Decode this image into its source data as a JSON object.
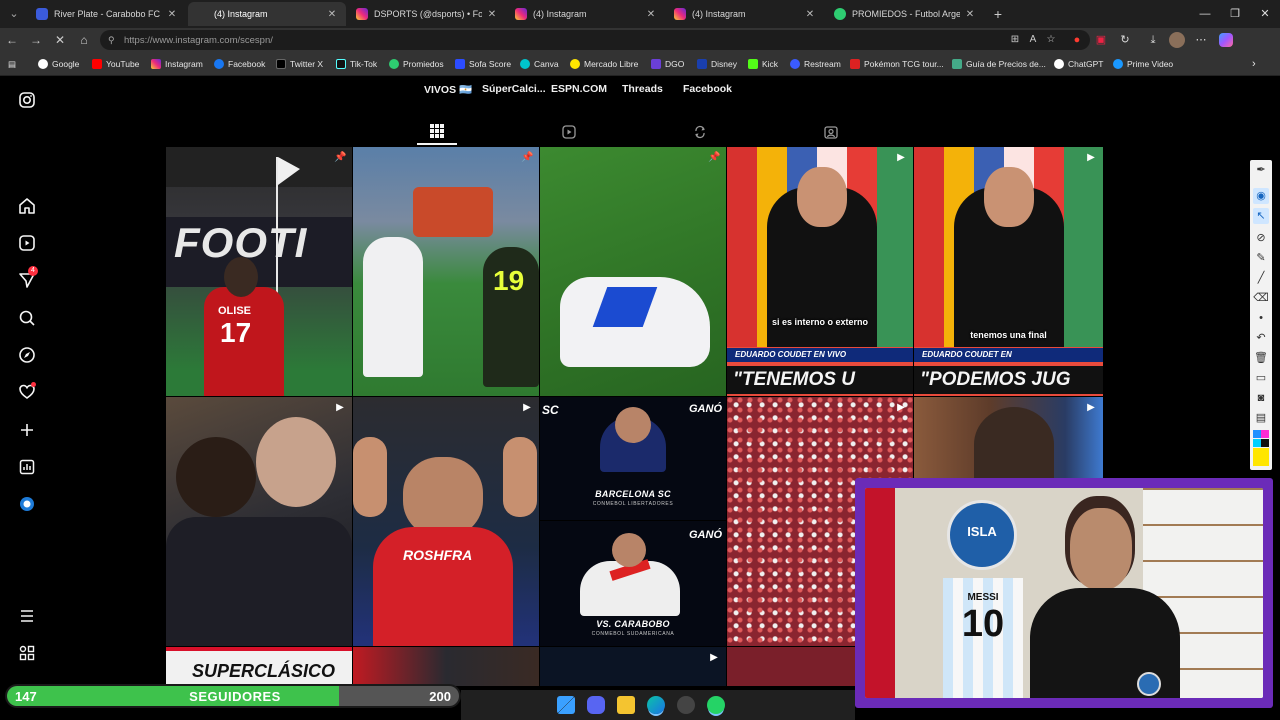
{
  "browser": {
    "tabs": [
      {
        "title": "River Plate - Carabobo FC en vivo",
        "active": false,
        "favicon": "river-plate-favicon"
      },
      {
        "title": "(4) Instagram",
        "active": true,
        "favicon": "instagram-favicon"
      },
      {
        "title": "DSPORTS (@dsports) • Fotos y vid",
        "active": false,
        "favicon": "instagram-favicon"
      },
      {
        "title": "(4) Instagram",
        "active": false,
        "favicon": "instagram-favicon"
      },
      {
        "title": "(4) Instagram",
        "active": false,
        "favicon": "instagram-favicon"
      },
      {
        "title": "PROMIEDOS - Futbol Argentino - ",
        "active": false,
        "favicon": "promiedos-favicon"
      }
    ],
    "url": "https://www.instagram.com/scespn/",
    "bookmarks": [
      {
        "label": "Google",
        "color": "#ffffff"
      },
      {
        "label": "YouTube",
        "color": "#ff0000"
      },
      {
        "label": "Instagram",
        "color": "#e1306c"
      },
      {
        "label": "Facebook",
        "color": "#1877f2"
      },
      {
        "label": "Twitter X",
        "color": "#000000"
      },
      {
        "label": "Tik-Tok",
        "color": "#111111"
      },
      {
        "label": "Promiedos",
        "color": "#2ecc71"
      },
      {
        "label": "Sofa Score",
        "color": "#2c4cff"
      },
      {
        "label": "Canva",
        "color": "#00c4cc"
      },
      {
        "label": "Mercado Libre",
        "color": "#ffe600"
      },
      {
        "label": "DGO",
        "color": "#6a3fd6"
      },
      {
        "label": "Disney",
        "color": "#1a3fae"
      },
      {
        "label": "Kick",
        "color": "#53fc18"
      },
      {
        "label": "Restream",
        "color": "#3a5bff"
      },
      {
        "label": "Pokémon TCG tour...",
        "color": "#d22"
      },
      {
        "label": "Guía de Precios de...",
        "color": "#4a8"
      },
      {
        "label": "ChatGPT",
        "color": "#ffffff"
      },
      {
        "label": "Prime Video",
        "color": "#1a98ff"
      }
    ]
  },
  "sidebar": {
    "items": [
      {
        "name": "instagram-logo-icon"
      },
      {
        "name": "home-icon"
      },
      {
        "name": "reels-icon"
      },
      {
        "name": "messages-icon",
        "badge": "4"
      },
      {
        "name": "search-icon"
      },
      {
        "name": "explore-icon"
      },
      {
        "name": "notifications-icon"
      },
      {
        "name": "create-icon"
      },
      {
        "name": "dashboard-icon"
      },
      {
        "name": "profile-avatar"
      },
      {
        "name": "more-menu-icon"
      },
      {
        "name": "also-from-meta-icon"
      }
    ]
  },
  "profile": {
    "links": [
      "VIVOS 🇦🇷",
      "SúperCalci...",
      "ESPN.COM",
      "Threads",
      "Facebook"
    ],
    "tabs": [
      "posts-tab",
      "reels-tab",
      "reposts-tab",
      "tagged-tab"
    ]
  },
  "posts": {
    "p4_caption": "si es interno o externo",
    "p4_banner": "EDUARDO COUDET EN VIVO",
    "p4_headline": "\"TENEMOS U",
    "p5_caption": "tenemos una final",
    "p5_banner": "EDUARDO COUDET EN",
    "p5_headline": "\"PODEMOS JUG",
    "p1_shirt_name": "OLISE",
    "p1_shirt_number": "17",
    "p1_board": "FOOTI",
    "p2_number": "19",
    "p7_sponsor": "ROSHFRA",
    "p8_result": "GANÓ",
    "p8_team": "BARCELONA SC",
    "p8_comp": "CONMEBOL LIBERTADORES",
    "p8_logo": "SC",
    "p9_result": "GANÓ",
    "p9_team": "VS. CARABOBO",
    "p9_comp": "CONMEBOL SUDAMERICANA",
    "p11_headline": "SUPERCLÁSICO"
  },
  "followers": {
    "current": "147",
    "label": "SEGUIDORES",
    "goal": "200",
    "progress": 0.735
  },
  "webcam": {
    "sign": "ISLA",
    "jersey_name": "MESSI",
    "jersey_number": "10"
  },
  "colors": {
    "accent_purple": "#6b2bb8",
    "follow_green": "#3ec24c",
    "ig_badge": "#ff3040"
  }
}
